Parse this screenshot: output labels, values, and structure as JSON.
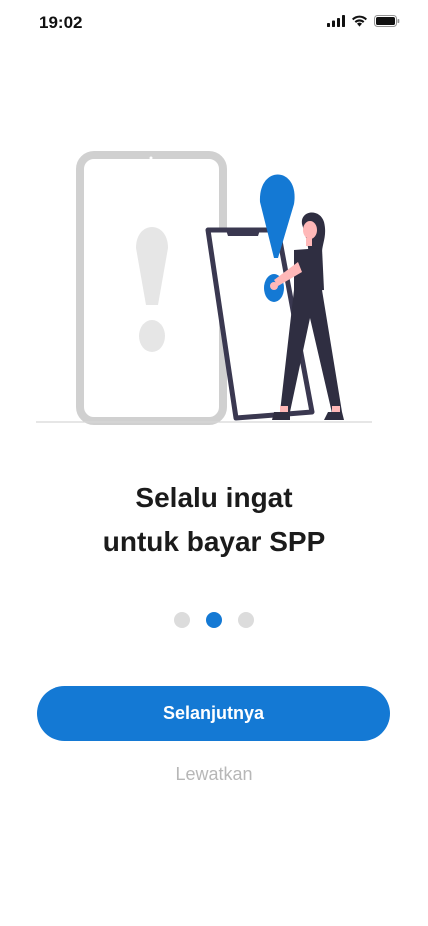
{
  "status_bar": {
    "time": "19:02",
    "icons": [
      "signal-icon",
      "wifi-icon",
      "battery-icon"
    ]
  },
  "onboarding": {
    "headline_line1": "Selalu ingat",
    "headline_line2": "untuk bayar SPP",
    "page_indicator": {
      "total": 3,
      "active_index": 1
    },
    "primary_button_label": "Selanjutnya",
    "skip_label": "Lewatkan"
  },
  "colors": {
    "accent": "#1479d4",
    "dot_inactive": "#dcdcdc",
    "headline": "#1b1b1b",
    "skip_text": "#b7b7b7",
    "device_frame": "#d0d0d0",
    "phone_outline": "#3a3850"
  }
}
